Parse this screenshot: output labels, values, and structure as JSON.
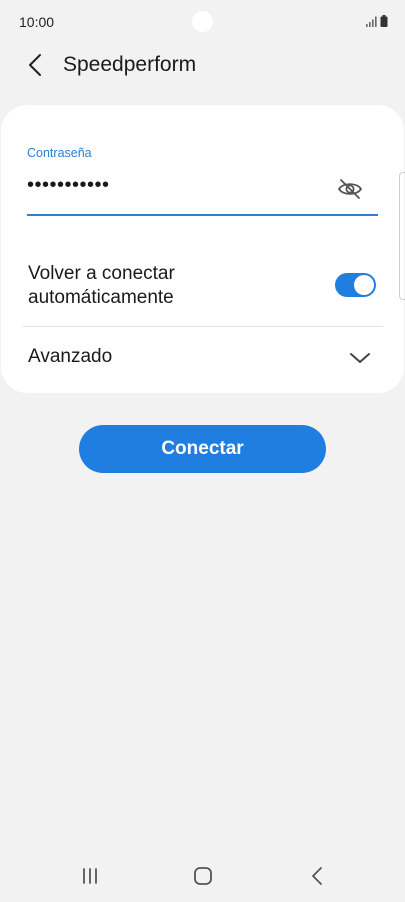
{
  "status_bar": {
    "time": "10:00",
    "icons": [
      "signal-icon",
      "battery-icon"
    ]
  },
  "header": {
    "title": "Speedperform",
    "back_icon": "chevron-left-icon"
  },
  "password": {
    "label": "Contraseña",
    "value": "•••••••••••",
    "visibility_icon": "eye-off-icon"
  },
  "reconnect": {
    "label": "Volver a conectar automáticamente",
    "enabled": true
  },
  "advanced": {
    "label": "Avanzado",
    "icon": "chevron-down-icon"
  },
  "connect_button": {
    "label": "Conectar"
  },
  "nav_bar": {
    "icons": [
      "recents-icon",
      "home-icon",
      "back-icon"
    ]
  },
  "colors": {
    "accent": "#1f7ee0",
    "label_blue": "#2b7fd4",
    "background": "#f2f2f2",
    "card": "#ffffff"
  }
}
